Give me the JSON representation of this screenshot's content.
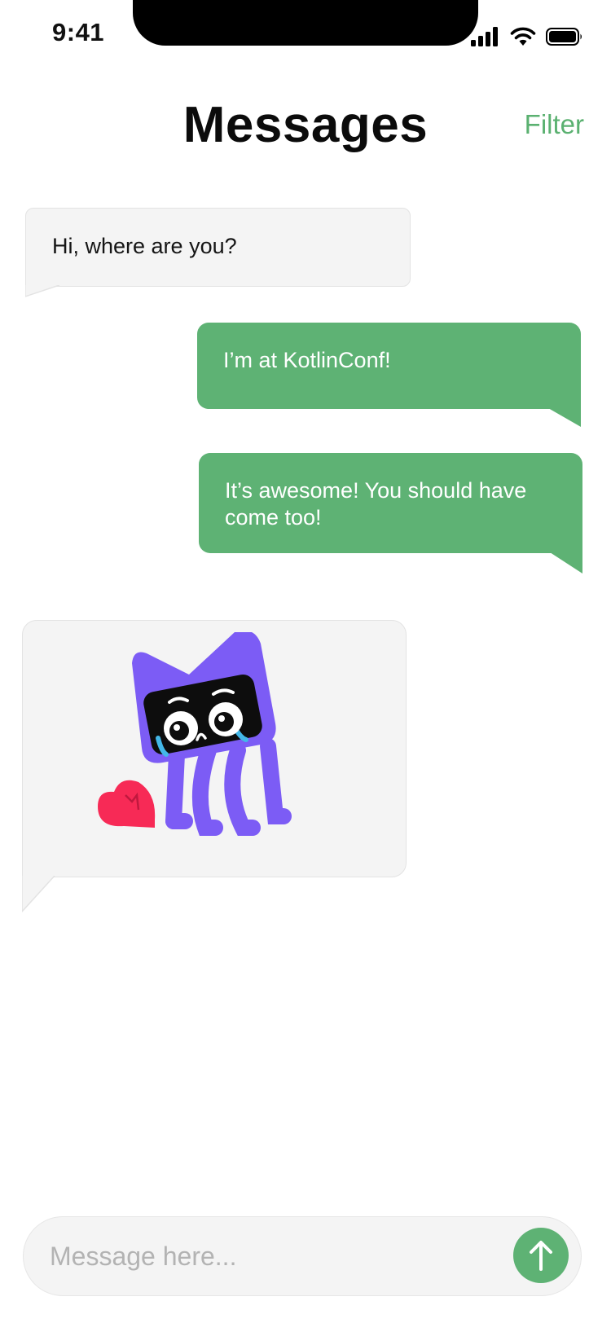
{
  "status_bar": {
    "time": "9:41",
    "icons": [
      "signal-icon",
      "wifi-icon",
      "battery-icon"
    ]
  },
  "header": {
    "title": "Messages",
    "filter_label": "Filter"
  },
  "messages": [
    {
      "direction": "incoming",
      "text": "Hi, where are you?"
    },
    {
      "direction": "outgoing",
      "text": "I’m at KotlinConf!"
    },
    {
      "direction": "outgoing",
      "text": "It’s awesome! You should have come too!"
    },
    {
      "direction": "incoming",
      "sticker": "crying-kotlin-mascot-with-heart-sticker"
    }
  ],
  "composer": {
    "placeholder": "Message here...",
    "value": "",
    "send_icon": "arrow-up-icon"
  },
  "colors": {
    "accent": "#5BB171",
    "outgoing_bubble": "#5EB274",
    "incoming_bubble": "#F4F4F4",
    "mascot": "#7C5CF5",
    "heart": "#F72A56"
  }
}
